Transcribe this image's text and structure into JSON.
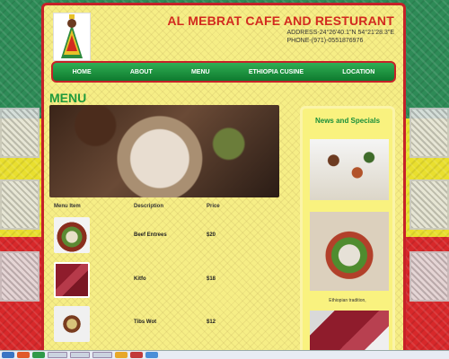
{
  "site": {
    "title": "AL MEBRAT CAFE AND RESTURANT",
    "address": "ADDRESS-24°26'40.1\"N 54°21'28.3\"E",
    "phone": "PHONE-(971)-0551876976"
  },
  "nav": [
    {
      "label": "HOME"
    },
    {
      "label": "ABOUT"
    },
    {
      "label": "MENU"
    },
    {
      "label": "ETHIOPIA CUSINE"
    },
    {
      "label": "LOCATION"
    }
  ],
  "menu": {
    "heading": "MENU",
    "headers": [
      "Menu Item",
      "Description",
      "Price"
    ],
    "rows": [
      {
        "name": "Beef Entrees",
        "price": "$20",
        "image": "ethiopian-platter"
      },
      {
        "name": "Kitfo",
        "price": "$18",
        "image": "raw-beef"
      },
      {
        "name": "Tibs Wot",
        "price": "$12",
        "image": "stew-plate"
      }
    ]
  },
  "news": {
    "title": "News and Specials",
    "caption": "Ethiopian tradition,"
  },
  "colors": {
    "title_red": "#d22a1f",
    "nav_green": "#1f8f3f",
    "heading_green": "#1e9a3c",
    "page_yellow": "#f6ee86"
  }
}
